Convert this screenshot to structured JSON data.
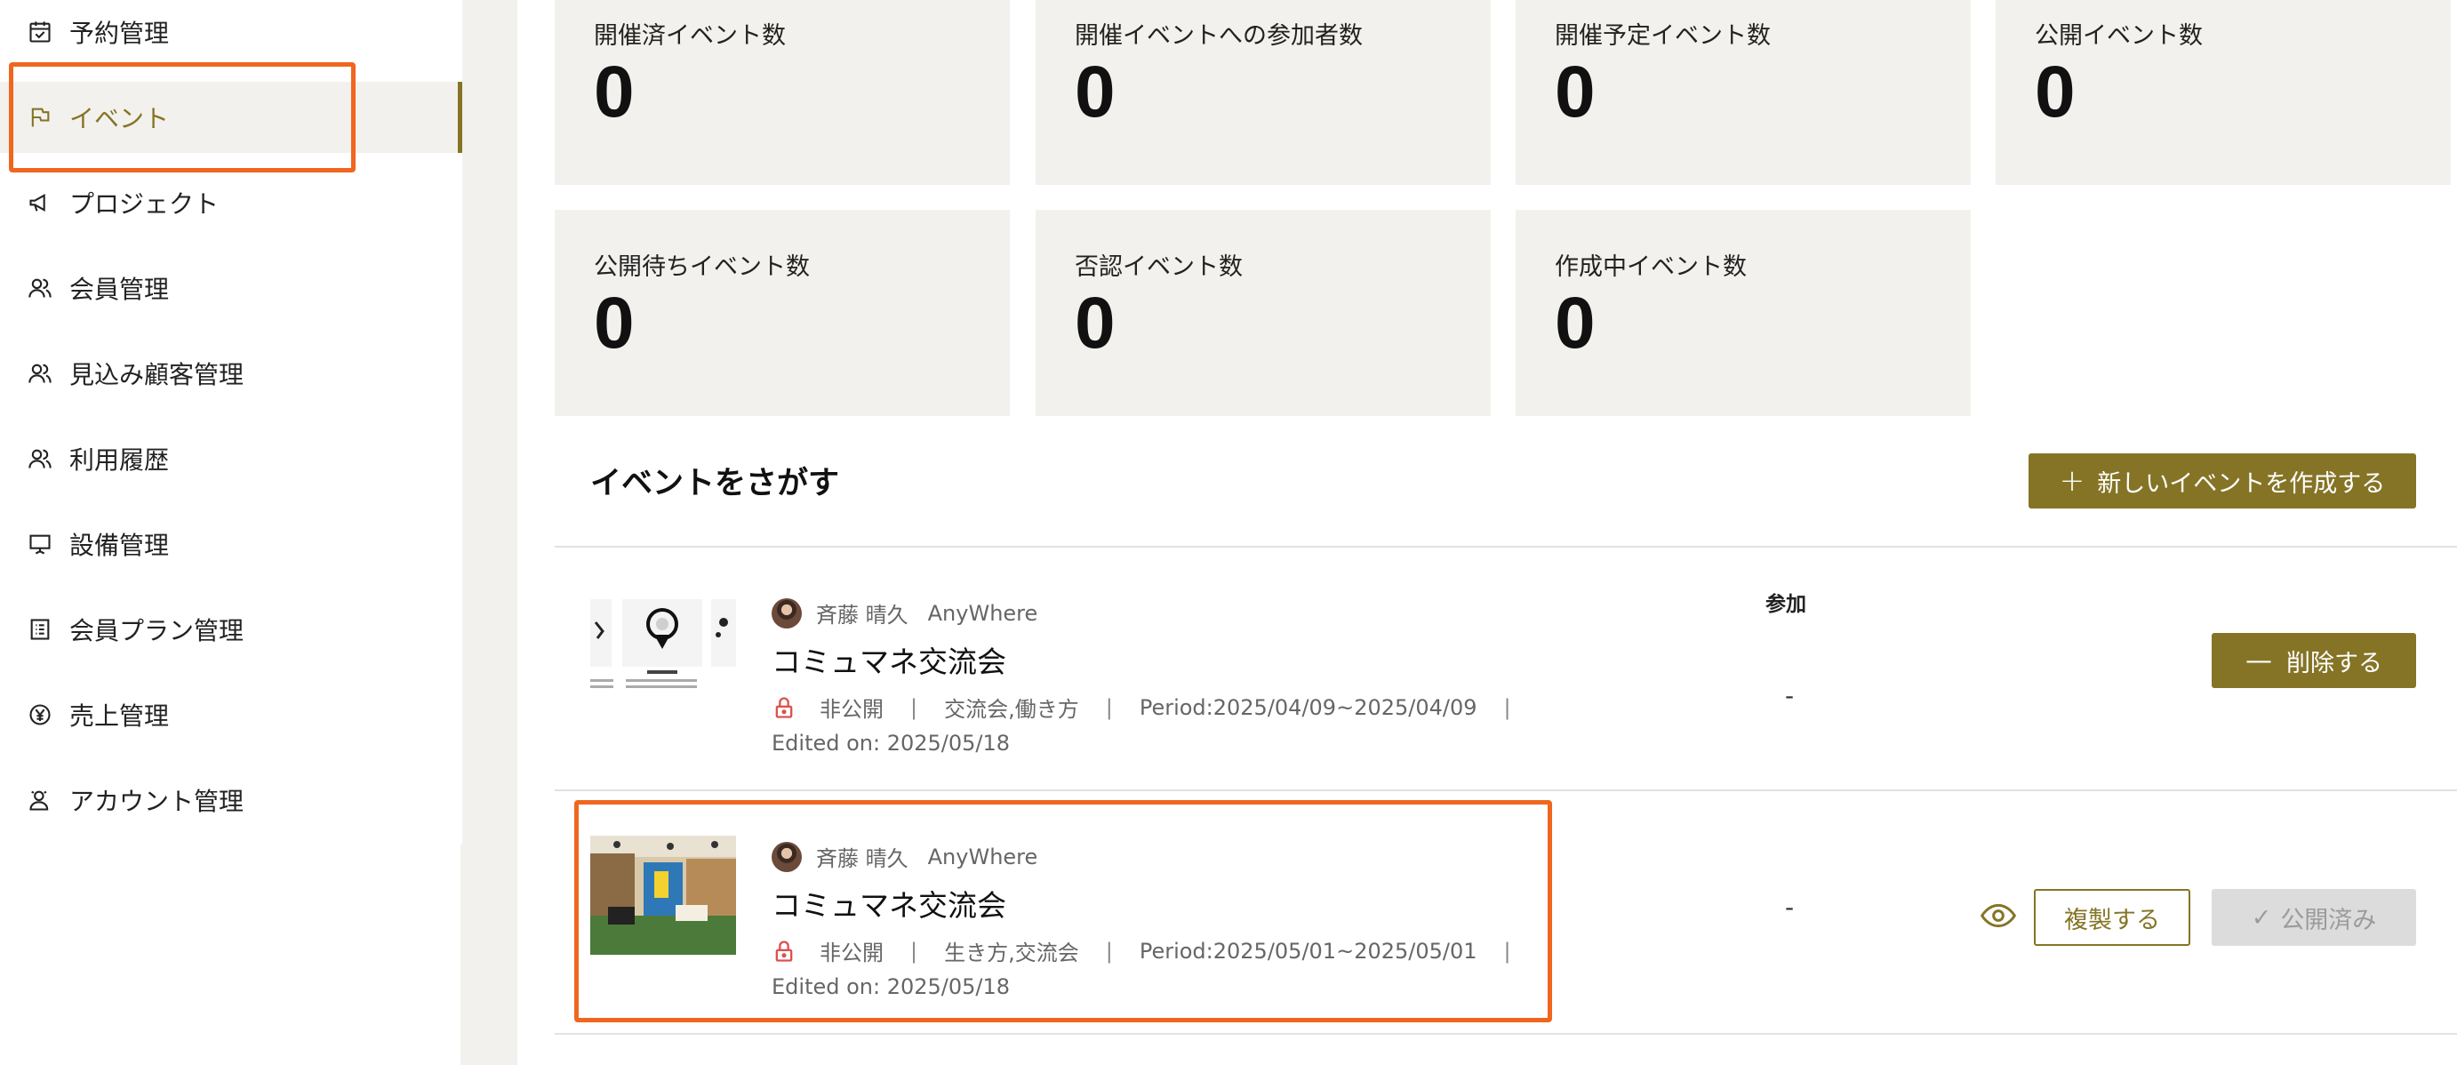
{
  "sidebar": {
    "items": [
      {
        "label": "予約管理",
        "icon": "calendar-check-icon"
      },
      {
        "label": "イベント",
        "icon": "flag-icon",
        "active": true
      },
      {
        "label": "プロジェクト",
        "icon": "megaphone-icon"
      },
      {
        "label": "会員管理",
        "icon": "users-icon"
      },
      {
        "label": "見込み顧客管理",
        "icon": "users-icon"
      },
      {
        "label": "利用履歴",
        "icon": "users-icon"
      },
      {
        "label": "設備管理",
        "icon": "presentation-board-icon"
      },
      {
        "label": "会員プラン管理",
        "icon": "list-icon"
      },
      {
        "label": "売上管理",
        "icon": "yen-circle-icon"
      },
      {
        "label": "アカウント管理",
        "icon": "user-gear-icon"
      }
    ]
  },
  "stats": [
    {
      "label": "開催済イベント数",
      "value": "0"
    },
    {
      "label": "開催イベントへの参加者数",
      "value": "0"
    },
    {
      "label": "開催予定イベント数",
      "value": "0"
    },
    {
      "label": "公開イベント数",
      "value": "0"
    },
    {
      "label": "公開待ちイベント数",
      "value": "0"
    },
    {
      "label": "否認イベント数",
      "value": "0"
    },
    {
      "label": "作成中イベント数",
      "value": "0"
    }
  ],
  "search": {
    "title": "イベントをさがす",
    "create_button": "新しいイベントを作成する"
  },
  "table": {
    "participation_header": "参加"
  },
  "events": [
    {
      "author": "斉藤 晴久",
      "org": "AnyWhere",
      "title": "コミュマネ交流会",
      "visibility": "非公開",
      "tags": "交流会,働き方",
      "period": "Period:2025/04/09~2025/04/09",
      "edited": "Edited on: 2025/05/18",
      "participation": "-",
      "action": "削除する"
    },
    {
      "author": "斉藤 晴久",
      "org": "AnyWhere",
      "title": "コミュマネ交流会",
      "visibility": "非公開",
      "tags": "生き方,交流会",
      "period": "Period:2025/05/01~2025/05/01",
      "edited": "Edited on: 2025/05/18",
      "participation": "-",
      "duplicate": "複製する",
      "published": "公開済み"
    }
  ],
  "separator": "|",
  "colors": {
    "accent": "#857426",
    "highlight": "#f0661e",
    "card_bg": "#f2f1ed",
    "lock": "#d9534f"
  }
}
